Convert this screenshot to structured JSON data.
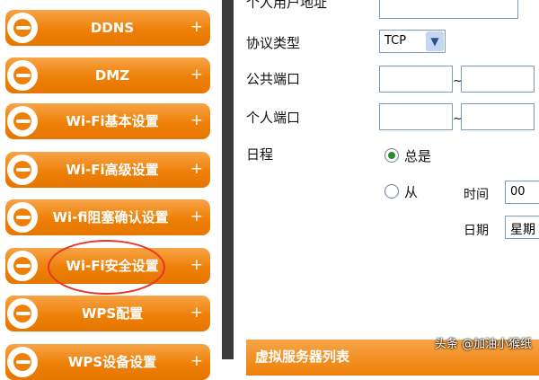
{
  "sidebar": {
    "items": [
      {
        "label": "DDNS",
        "expand": "+"
      },
      {
        "label": "DMZ",
        "expand": "+"
      },
      {
        "label": "Wi-Fi基本设置",
        "expand": "+"
      },
      {
        "label": "Wi-Fi高级设置",
        "expand": "+"
      },
      {
        "label": "Wi-fi阻塞确认设置",
        "expand": "+"
      },
      {
        "label": "Wi-Fi安全设置",
        "expand": "+"
      },
      {
        "label": "WPS配置",
        "expand": "+"
      },
      {
        "label": "WPS设备设置",
        "expand": "+"
      }
    ],
    "annotation_color": "#e8332c"
  },
  "form": {
    "private_user_address_label": "个人用户地址",
    "protocol_label": "协议类型",
    "protocol_value": "TCP",
    "public_port_label": "公共端口",
    "private_port_label": "个人端口",
    "port_separator": "~",
    "schedule_label": "日程",
    "schedule_always": "总是",
    "schedule_from": "从",
    "time_label": "时间",
    "time_value": "00",
    "date_label": "日期",
    "date_value": "星期"
  },
  "section": {
    "title": "虚拟服务器列表"
  },
  "watermark": "头条 @加油小猴纸",
  "colors": {
    "accent_orange": "#ee8008",
    "divider": "#3b3b3b",
    "input_border": "#7f9db9"
  }
}
